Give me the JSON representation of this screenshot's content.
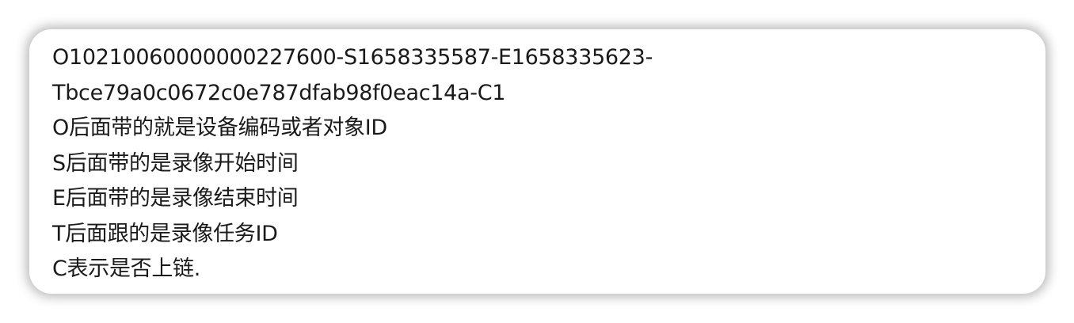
{
  "lines": [
    "O10210060000000227600-S1658335587-E1658335623-",
    "Tbce79a0c0672c0e787dfab98f0eac14a-C1",
    "O后面带的就是设备编码或者对象ID",
    "S后面带的是录像开始时间",
    "E后面带的是录像结束时间",
    "T后面跟的是录像任务ID",
    "C表示是否上链."
  ]
}
